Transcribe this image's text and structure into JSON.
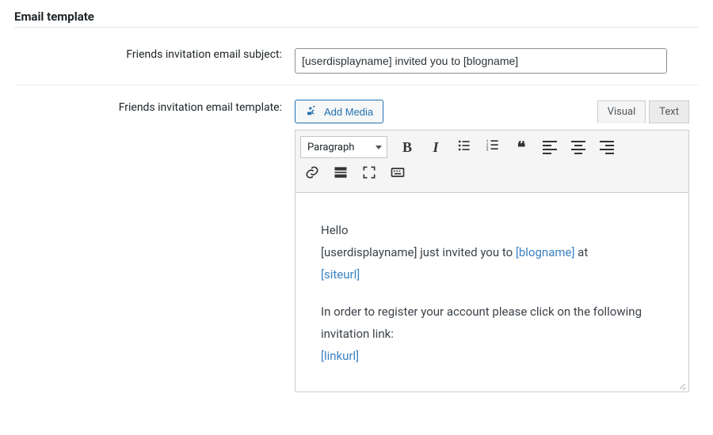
{
  "section": {
    "title": "Email template"
  },
  "rows": {
    "subject": {
      "label": "Friends invitation email subject:",
      "value": "[userdisplayname] invited you to [blogname]"
    },
    "template": {
      "label": "Friends invitation email template:",
      "add_media": "Add Media",
      "tabs": {
        "visual": "Visual",
        "text": "Text",
        "active": "visual"
      },
      "format_selected": "Paragraph",
      "body": {
        "greeting": "Hello",
        "line1_pre": "[userdisplayname] just invited you to ",
        "line1_link": "[blogname]",
        "line1_post": " at ",
        "line1_link2": "[siteurl]",
        "para2": "In order to register your account please click on the following invitation link:",
        "link3": "[linkurl]"
      }
    }
  }
}
